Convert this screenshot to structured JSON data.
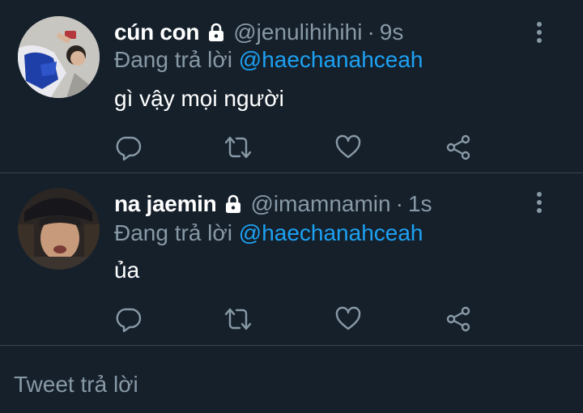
{
  "tweets": [
    {
      "display_name": "cún con",
      "handle": "@jenulihihihi",
      "separator": "·",
      "time": "9s",
      "reply_prefix": "Đang trả lời",
      "reply_to": "@haechanahceah",
      "text": "gì vậy mọi người",
      "protected": true
    },
    {
      "display_name": "na jaemin",
      "handle": "@imamnamin",
      "separator": "·",
      "time": "1s",
      "reply_prefix": "Đang trả lời",
      "reply_to": "@haechanahceah",
      "text": "ủa",
      "protected": true
    }
  ],
  "compose": {
    "placeholder": "Tweet trả lời"
  },
  "colors": {
    "background": "#15202b",
    "divider": "#38444d",
    "secondary_text": "#8899a6",
    "link": "#1da1f2",
    "icon": "#8899a6"
  },
  "icons": {
    "reply": "reply-icon",
    "retweet": "retweet-icon",
    "like": "heart-icon",
    "share": "share-icon",
    "more": "more-vertical-icon",
    "lock": "lock-icon"
  }
}
